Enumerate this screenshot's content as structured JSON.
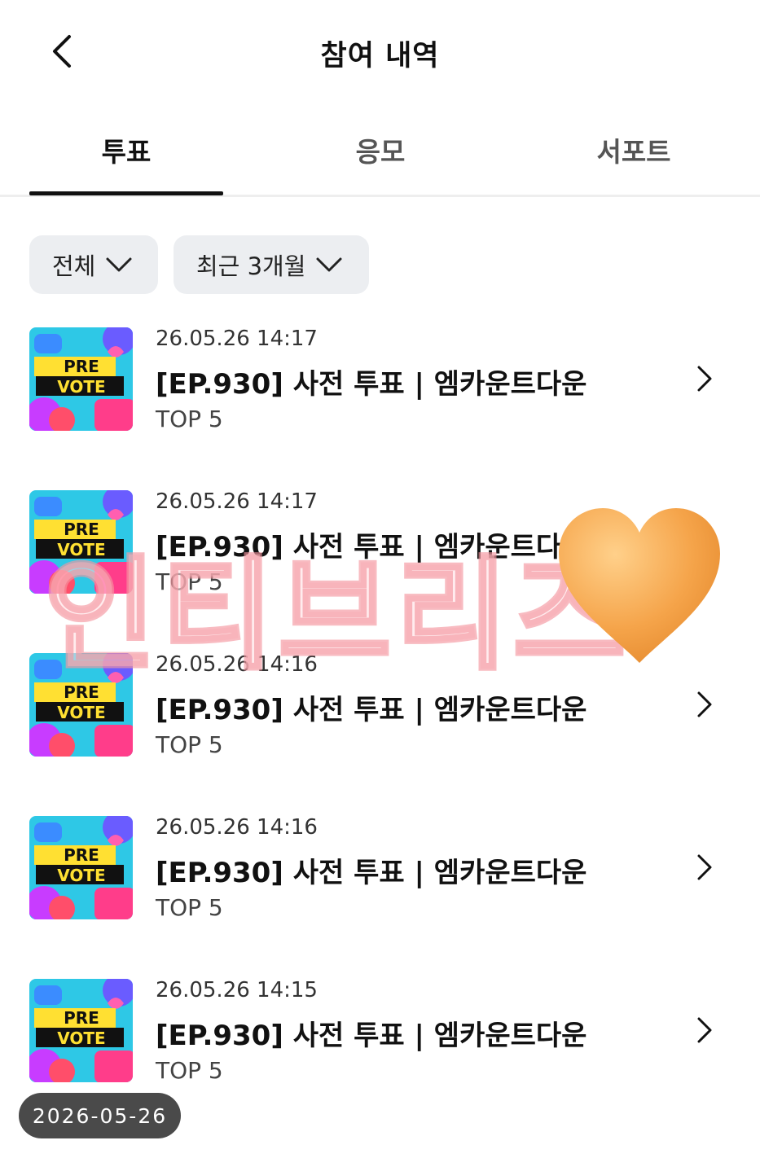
{
  "header": {
    "title": "참여 내역",
    "back_icon": "chevron-left-icon"
  },
  "tabs": [
    {
      "label": "투표",
      "active": true
    },
    {
      "label": "응모",
      "active": false
    },
    {
      "label": "서포트",
      "active": false
    }
  ],
  "filters": [
    {
      "label": "전체",
      "icon": "chevron-down-icon"
    },
    {
      "label": "최근 3개월",
      "icon": "chevron-down-icon"
    }
  ],
  "thumbnail": {
    "line1": "PRE",
    "line2": "VOTE"
  },
  "items": [
    {
      "date": "26.05.26 14:17",
      "title": "[EP.930] 사전 투표 | 엠카운트다운",
      "rank": "TOP 5"
    },
    {
      "date": "26.05.26 14:17",
      "title": "[EP.930] 사전 투표 | 엠카운트다운",
      "rank": "TOP 5"
    },
    {
      "date": "26.05.26 14:16",
      "title": "[EP.930] 사전 투표 | 엠카운트다운",
      "rank": "TOP 5"
    },
    {
      "date": "26.05.26 14:16",
      "title": "[EP.930] 사전 투표 | 엠카운트다운",
      "rank": "TOP 5"
    },
    {
      "date": "26.05.26 14:15",
      "title": "[EP.930] 사전 투표 | 엠카운트다운",
      "rank": "TOP 5"
    }
  ],
  "watermark": {
    "text": "인티브리즈",
    "icon": "orange-heart-icon"
  },
  "date_pill": "2026-05-26",
  "colors": {
    "text_primary": "#111111",
    "filter_bg": "#eceef1",
    "pill_bg": "#4a4a4a",
    "heart": "#f5a44a"
  }
}
